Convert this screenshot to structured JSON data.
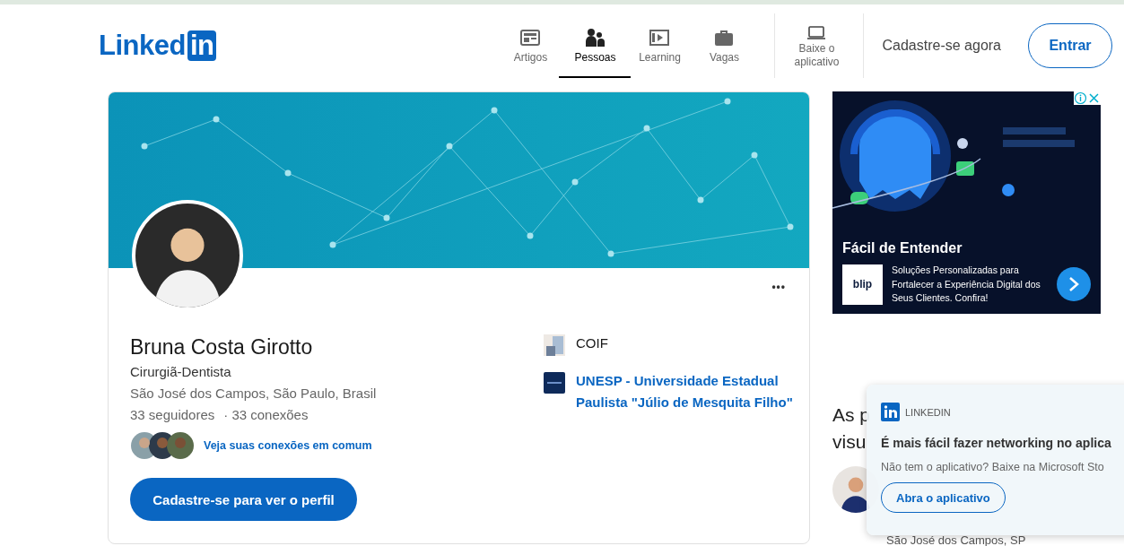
{
  "header": {
    "logo": {
      "word": "Linked",
      "badge": "in"
    },
    "nav": [
      {
        "label": "Artigos",
        "selected": false
      },
      {
        "label": "Pessoas",
        "selected": true
      },
      {
        "label": "Learning",
        "selected": false
      },
      {
        "label": "Vagas",
        "selected": false
      }
    ],
    "app_link": {
      "label": "Baixe o aplicativo"
    },
    "join": "Cadastre-se agora",
    "sign_in": "Entrar"
  },
  "profile": {
    "name": "Bruna Costa Girotto",
    "headline": "Cirurgiã-Dentista",
    "location": "São José dos Campos, São Paulo, Brasil",
    "followers": "33 seguidores",
    "connections": "· 33 conexões",
    "mutual": "Veja suas conexões em comum",
    "cta": "Cadastre-se para ver o perfil",
    "more": "•••",
    "orgs": [
      {
        "name": "COIF",
        "kind": "company"
      },
      {
        "name": "UNESP - Universidade Estadual Paulista \"Júlio de Mesquita Filho\"",
        "kind": "school"
      }
    ]
  },
  "ad": {
    "title": "Fácil de Entender",
    "logo": "blip",
    "text": "Soluções Personalizadas para Fortalecer a Experiência Digital dos Seus Clientes. Confira!"
  },
  "people": {
    "heading": [
      "As p",
      "visu"
    ],
    "location": "São José dos Campos, SP"
  },
  "toast": {
    "source": "LINKEDIN",
    "title": "É mais fácil fazer networking no aplica",
    "text": "Não tem o aplicativo? Baixe na Microsoft Sto",
    "button": "Abra o aplicativo"
  }
}
